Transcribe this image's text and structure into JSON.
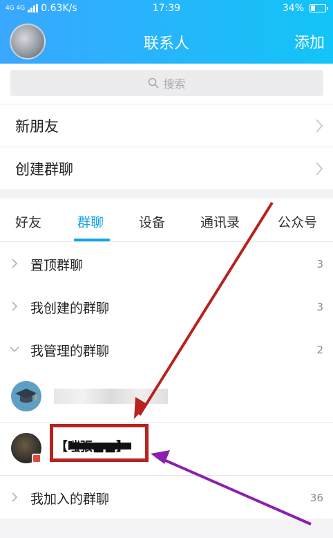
{
  "status_bar": {
    "network_type": "4G 4G",
    "speed": "0.63K/s",
    "time": "17:39",
    "battery_percent": "34%",
    "battery_level": 0.34
  },
  "header": {
    "title": "联系人",
    "add_label": "添加"
  },
  "search": {
    "placeholder": "搜索"
  },
  "quick_rows": [
    {
      "label": "新朋友"
    },
    {
      "label": "创建群聊"
    }
  ],
  "tabs": [
    {
      "label": "好友"
    },
    {
      "label": "群聊"
    },
    {
      "label": "设备"
    },
    {
      "label": "通讯录"
    },
    {
      "label": "公众号"
    }
  ],
  "active_tab": "群聊",
  "groups": [
    {
      "label": "置顶群聊",
      "count": "3",
      "expanded": false
    },
    {
      "label": "我创建的群聊",
      "count": "3",
      "expanded": false
    },
    {
      "label": "我管理的群聊",
      "count": "2",
      "expanded": true
    },
    {
      "label": "我加入的群聊",
      "count": "36",
      "expanded": false
    }
  ],
  "managed_groups": [
    {
      "name": ""
    },
    {
      "name": "【嗤張■■】"
    }
  ],
  "colors": {
    "accent": "#12a4f0",
    "header_start": "#3aa7ff",
    "header_end": "#12c4f7",
    "red_annotation": "#b8231f",
    "purple_annotation": "#8a1fb0"
  }
}
